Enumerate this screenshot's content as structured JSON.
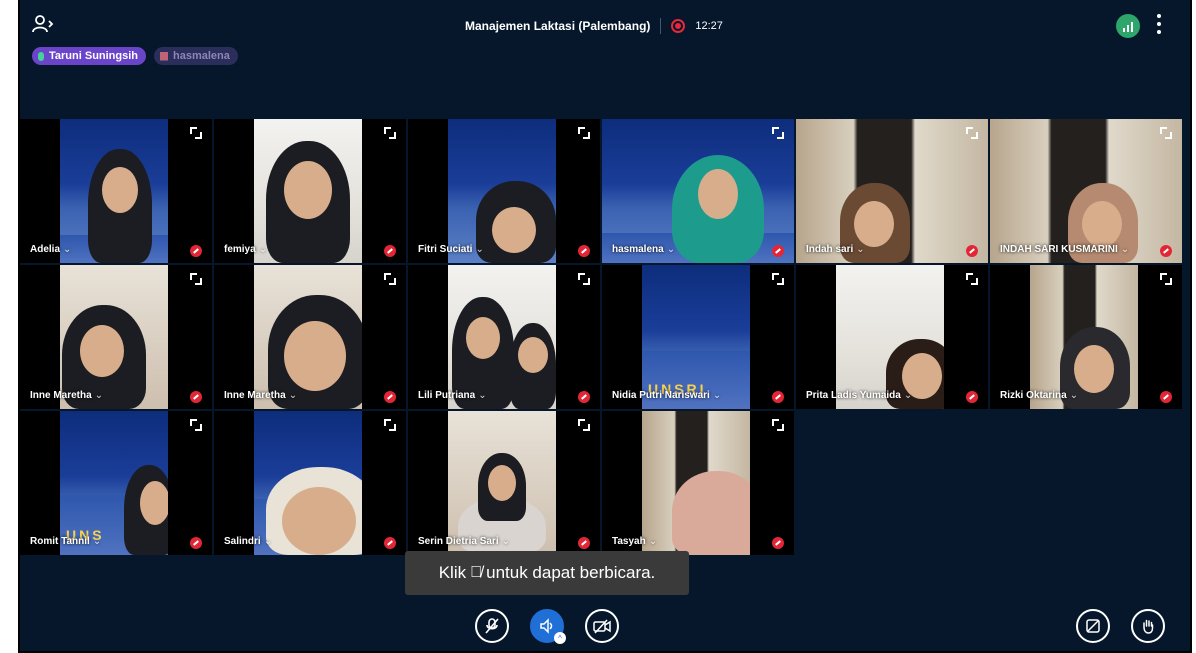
{
  "window": {
    "title": "Manajemen Laktasi (Palembang)",
    "recording_time": "12:27"
  },
  "icons": {
    "users": "users-panel-icon",
    "record": "record-icon",
    "signal": "connection-signal-icon",
    "more": "more-options-icon",
    "expand": "expand-icon",
    "muted": "muted-mic-icon"
  },
  "colors": {
    "background": "#06172b",
    "accent": "#1f6fd6",
    "record": "#e5283a",
    "signal": "#2ea56b",
    "talker_primary": "#6a45c9"
  },
  "talkers": [
    {
      "name": "Taruni Suningsih"
    },
    {
      "name": "hasmalena"
    }
  ],
  "participants": [
    {
      "name": "Adelia"
    },
    {
      "name": "femiya"
    },
    {
      "name": "Fitri Suciati"
    },
    {
      "name": "hasmalena"
    },
    {
      "name": "Indah sari"
    },
    {
      "name": "INDAH SARI KUSMARINI"
    },
    {
      "name": "Inne Maretha"
    },
    {
      "name": "Inne Maretha"
    },
    {
      "name": "Lili Putriana"
    },
    {
      "name": "Nidia Putri Nariswari"
    },
    {
      "name": "Prita Ladis Yumaida"
    },
    {
      "name": "Rizki Oktarina"
    },
    {
      "name": "Romit Tannil"
    },
    {
      "name": "Salindri"
    },
    {
      "name": "Serin Dietria Sari"
    },
    {
      "name": "Tasyah"
    }
  ],
  "tooltip": {
    "before": "Klik",
    "after": "untuk dapat berbicara."
  },
  "controls": {
    "mic": "microphone-off-icon",
    "speaker": "speaker-icon",
    "camera": "camera-off-icon",
    "screen": "screen-share-off-icon",
    "hand": "raise-hand-icon"
  }
}
